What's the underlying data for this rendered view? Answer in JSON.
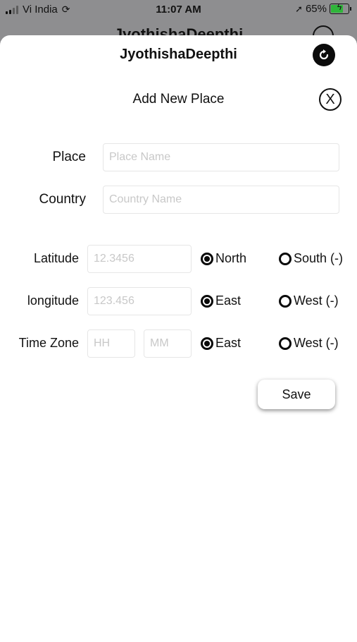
{
  "status_bar": {
    "carrier": "Vi India",
    "time": "11:07 AM",
    "battery_percent": "65%"
  },
  "background_app": {
    "title": "JyothishaDeepthi"
  },
  "header": {
    "title": "JyothishaDeepthi",
    "refresh_icon": "refresh-icon"
  },
  "dialog": {
    "title": "Add New Place",
    "close_icon": "close-icon",
    "close_glyph": "X"
  },
  "form": {
    "place": {
      "label": "Place",
      "placeholder": "Place Name",
      "value": ""
    },
    "country": {
      "label": "Country",
      "placeholder": "Country Name",
      "value": ""
    },
    "latitude": {
      "label": "Latitude",
      "placeholder": "12.3456",
      "value": "",
      "options": [
        "North",
        "South (-)"
      ],
      "selected": "North"
    },
    "longitude": {
      "label": "longitude",
      "placeholder": "123.456",
      "value": "",
      "options": [
        "East",
        "West (-)"
      ],
      "selected": "East"
    },
    "timezone": {
      "label": "Time Zone",
      "hours_placeholder": "HH",
      "minutes_placeholder": "MM",
      "options": [
        "East",
        "West (-)"
      ],
      "selected": "East"
    },
    "save_label": "Save"
  }
}
